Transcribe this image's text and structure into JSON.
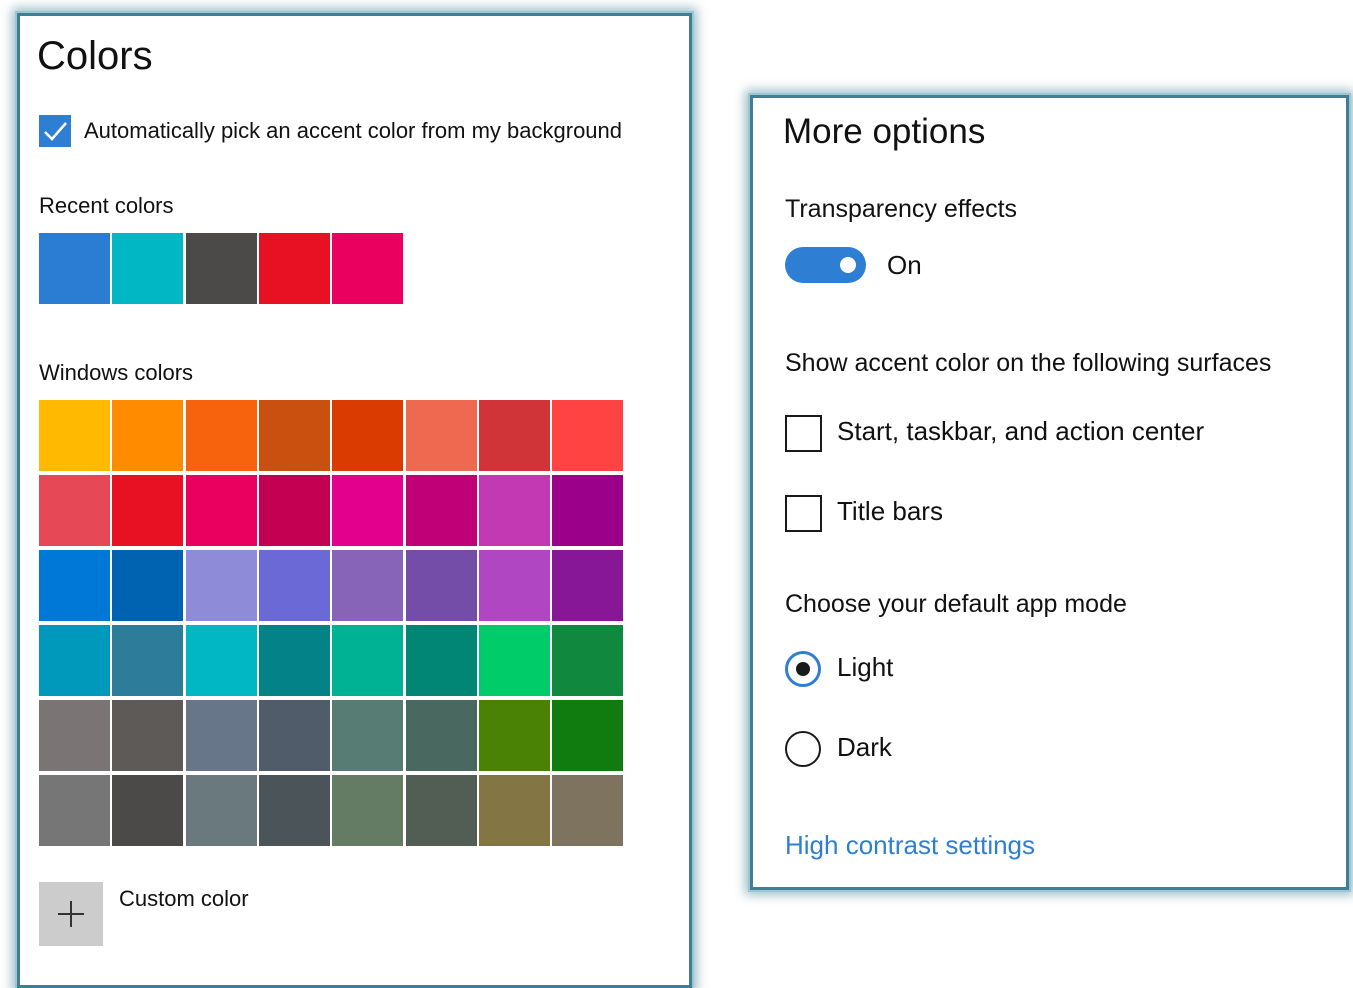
{
  "colors_panel": {
    "title": "Colors",
    "auto_pick": {
      "label": "Automatically pick an accent color from my background",
      "checked": true
    },
    "recent_colors": {
      "heading": "Recent colors",
      "swatches": [
        "#2b7cd3",
        "#00b7c3",
        "#4c4a48",
        "#e81123",
        "#ea005e"
      ]
    },
    "windows_colors": {
      "heading": "Windows colors",
      "rows": [
        [
          "#ffb900",
          "#ff8c00",
          "#f7630c",
          "#ca5010",
          "#da3b01",
          "#ef6950",
          "#d13438",
          "#ff4343"
        ],
        [
          "#e74856",
          "#e81123",
          "#ea005e",
          "#c30052",
          "#e3008c",
          "#bf0077",
          "#c239b3",
          "#9a0089"
        ],
        [
          "#0078d7",
          "#0063b1",
          "#8e8cd8",
          "#6b69d6",
          "#8764b8",
          "#744da9",
          "#b146c2",
          "#881798"
        ],
        [
          "#0099bc",
          "#2d7d9a",
          "#00b7c3",
          "#038387",
          "#00b294",
          "#018574",
          "#00cc6a",
          "#10893e"
        ],
        [
          "#7a7574",
          "#5d5a58",
          "#68768a",
          "#515c6b",
          "#567c73",
          "#486860",
          "#498205",
          "#107c10"
        ],
        [
          "#767676",
          "#4c4a48",
          "#69797e",
          "#4a5459",
          "#647c64",
          "#525e54",
          "#847545",
          "#7e735f"
        ]
      ]
    },
    "custom_color": {
      "label": "Custom color",
      "icon": "plus-icon"
    }
  },
  "options_panel": {
    "title": "More options",
    "transparency": {
      "label": "Transparency effects",
      "state_label": "On",
      "on": true
    },
    "accent_surfaces": {
      "heading": "Show accent color on the following surfaces",
      "items": [
        {
          "label": "Start, taskbar, and action center",
          "checked": false
        },
        {
          "label": "Title bars",
          "checked": false
        }
      ]
    },
    "app_mode": {
      "heading": "Choose your default app mode",
      "options": [
        {
          "label": "Light",
          "selected": true
        },
        {
          "label": "Dark",
          "selected": false
        }
      ]
    },
    "high_contrast_link": "High contrast settings"
  },
  "accent_color": "#2e7fd4"
}
